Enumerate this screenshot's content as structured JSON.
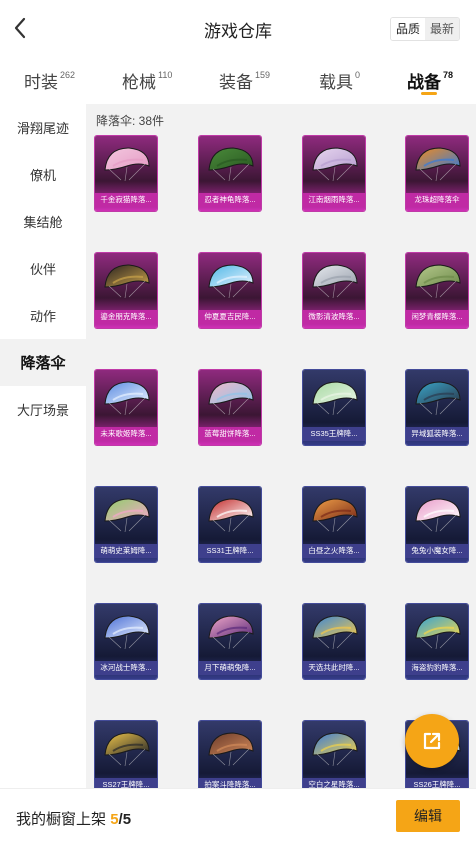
{
  "header": {
    "title": "游戏仓库",
    "sort_options": [
      "品质",
      "最新"
    ],
    "sort_selected": "品质"
  },
  "tabs": [
    {
      "label": "时装",
      "count": "262"
    },
    {
      "label": "枪械",
      "count": "110"
    },
    {
      "label": "装备",
      "count": "159"
    },
    {
      "label": "载具",
      "count": "0"
    },
    {
      "label": "战备",
      "count": "78"
    }
  ],
  "active_tab": "战备",
  "sidebar": {
    "items": [
      "滑翔尾迹",
      "僚机",
      "集结舱",
      "伙伴",
      "动作",
      "降落伞",
      "大厅场景"
    ],
    "active": "降落伞"
  },
  "content": {
    "count_label": "降落伞: 38件",
    "items": [
      {
        "name": "千金寂猫降落...",
        "tier": "purple",
        "colors": [
          "#f3c7df",
          "#e59bc4"
        ]
      },
      {
        "name": "忍者神龟降落...",
        "tier": "purple",
        "colors": [
          "#4a8a3a",
          "#2a5a22"
        ]
      },
      {
        "name": "江南烟雨降落...",
        "tier": "purple",
        "colors": [
          "#e7d6ef",
          "#b79ed0"
        ]
      },
      {
        "name": "龙珠超降落伞",
        "tier": "purple",
        "colors": [
          "#f08a1e",
          "#3a7bd5"
        ]
      },
      {
        "name": "鎏金朋克降落...",
        "tier": "purple",
        "colors": [
          "#2a2320",
          "#c9a24a"
        ]
      },
      {
        "name": "仲夏夏吉民降...",
        "tier": "purple",
        "colors": [
          "#4fb7e6",
          "#e7f3ff"
        ]
      },
      {
        "name": "微影清波降落...",
        "tier": "purple",
        "colors": [
          "#e6e9ee",
          "#9aa1ad"
        ]
      },
      {
        "name": "闲梦青樱降落...",
        "tier": "purple",
        "colors": [
          "#b5c98c",
          "#6d8a4a"
        ]
      },
      {
        "name": "未来歌姬降落...",
        "tier": "purple",
        "colors": [
          "#5a8be0",
          "#e7f1ff"
        ]
      },
      {
        "name": "蓝莓甜饼降落...",
        "tier": "purple",
        "colors": [
          "#f0b8c8",
          "#8fc3e8"
        ]
      },
      {
        "name": "SS35王牌降...",
        "tier": "blue",
        "colors": [
          "#a7d9a2",
          "#e9f5e6"
        ]
      },
      {
        "name": "异域狐装降落...",
        "tier": "blue",
        "colors": [
          "#3aa6c9",
          "#2b3b4f"
        ]
      },
      {
        "name": "萌萌史莱姆降...",
        "tier": "blue",
        "colors": [
          "#8fce6a",
          "#f3a7c9"
        ]
      },
      {
        "name": "SS31王牌降...",
        "tier": "blue",
        "colors": [
          "#c22a2a",
          "#ffffff"
        ]
      },
      {
        "name": "白昼之火降落...",
        "tier": "blue",
        "colors": [
          "#f0a048",
          "#7a2a18"
        ]
      },
      {
        "name": "兔兔小魔女降...",
        "tier": "blue",
        "colors": [
          "#e89ac8",
          "#ffffff"
        ]
      },
      {
        "name": "冰河战士降落...",
        "tier": "blue",
        "colors": [
          "#4a6fd4",
          "#e7efff"
        ]
      },
      {
        "name": "月下萌萌兔降...",
        "tier": "blue",
        "colors": [
          "#f0a8c8",
          "#5a2a7a"
        ]
      },
      {
        "name": "天选共此时降...",
        "tier": "blue",
        "colors": [
          "#3a86d8",
          "#f2c84b"
        ]
      },
      {
        "name": "海盗豹豹降落...",
        "tier": "blue",
        "colors": [
          "#2fa0d8",
          "#f2d64b"
        ]
      },
      {
        "name": "SS27王牌降...",
        "tier": "blue",
        "colors": [
          "#f0c64a",
          "#2a2a2a"
        ]
      },
      {
        "name": "拍案斗降降落...",
        "tier": "blue",
        "colors": [
          "#6a3a2a",
          "#d28a5a"
        ]
      },
      {
        "name": "空白之星降落...",
        "tier": "blue",
        "colors": [
          "#3a7ad8",
          "#f0d24a"
        ]
      },
      {
        "name": "SS26王牌降...",
        "tier": "blue",
        "colors": [
          "#2f9fd8",
          "#ffffff"
        ]
      }
    ]
  },
  "footer": {
    "showcase_label": "我的橱窗上架",
    "current": "5",
    "separator": "/",
    "total": "5",
    "edit_label": "编辑"
  },
  "icons": {
    "back": "chevron-left-icon",
    "share": "external-link-icon"
  },
  "colors": {
    "accent": "#f5a516",
    "purple_tier": "#c02aa4",
    "blue_tier": "#3e3f8c"
  }
}
